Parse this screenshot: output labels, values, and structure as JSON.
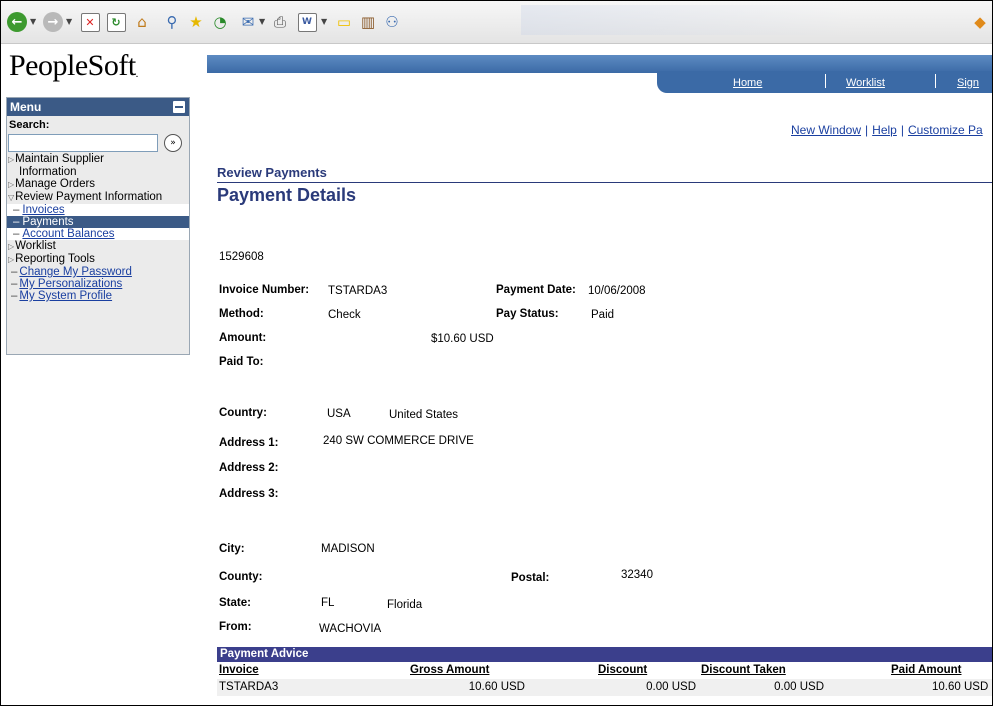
{
  "header": {
    "logo": "PeopleSoft",
    "logo_mark": ".",
    "nav": [
      "Home",
      "Worklist",
      "Sign"
    ]
  },
  "menu": {
    "title": "Menu",
    "search_label": "Search:",
    "search_value": "",
    "items": {
      "maintain_supplier_1": "Maintain Supplier",
      "maintain_supplier_2": "Information",
      "manage_orders": "Manage Orders",
      "review_payment": "Review Payment Information",
      "invoices": "Invoices",
      "payments": "Payments",
      "account_balances": "Account Balances",
      "worklist": "Worklist",
      "reporting_tools": "Reporting Tools",
      "change_password": "Change My Password",
      "personalizations": "My Personalizations",
      "system_profile": "My System Profile"
    }
  },
  "toplinks": {
    "new_window": "New Window",
    "help": "Help",
    "customize": "Customize Pa"
  },
  "page": {
    "breadcrumb": "Review Payments",
    "title": "Payment Details",
    "payment_id": "1529608"
  },
  "fields": {
    "invoice_number_label": "Invoice Number:",
    "invoice_number": "TSTARDA3",
    "payment_date_label": "Payment Date:",
    "payment_date": "10/06/2008",
    "method_label": "Method:",
    "method": "Check",
    "pay_status_label": "Pay Status:",
    "pay_status": "Paid",
    "amount_label": "Amount:",
    "amount": "$10.60",
    "amount_currency": "USD",
    "paid_to_label": "Paid To:",
    "country_label": "Country:",
    "country_code": "USA",
    "country_name": "United States",
    "address1_label": "Address 1:",
    "address1": "240 SW COMMERCE DRIVE",
    "address2_label": "Address 2:",
    "address3_label": "Address 3:",
    "city_label": "City:",
    "city": "MADISON",
    "county_label": "County:",
    "postal_label": "Postal:",
    "postal": "32340",
    "state_label": "State:",
    "state_code": "FL",
    "state_name": "Florida",
    "from_label": "From:",
    "from": "WACHOVIA"
  },
  "payment_advice": {
    "title": "Payment Advice",
    "columns": [
      "Invoice",
      "Gross Amount",
      "Discount",
      "Discount Taken",
      "Paid Amount"
    ],
    "rows": [
      [
        "TSTARDA3",
        "10.60 USD",
        "0.00 USD",
        "0.00 USD",
        "10.60 USD"
      ]
    ]
  }
}
